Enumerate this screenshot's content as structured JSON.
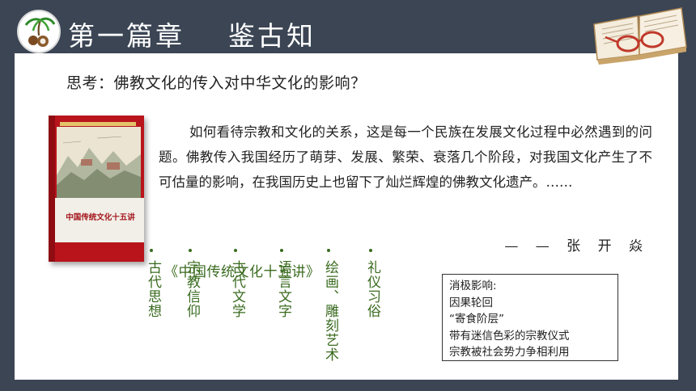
{
  "header": {
    "title": "第一篇章    鉴古知"
  },
  "question": "思考：佛教文化的传入对中华文化的影响？",
  "book": {
    "cover_title": "中国传统文化十五讲"
  },
  "paragraph": "如何看待宗教和文化的关系，这是每一个民族在发展文化过程中必然遇到的问题。佛教传入我国经历了萌芽、发展、繁荣、衰落几个阶段，对我国文化产生了不可估量的影响，在我国历史上也留下了灿烂辉煌的佛教文化遗产。……",
  "signature": "— — 张 开 焱",
  "book_reference": "《中国传统文化十五讲》",
  "influences": [
    "古代思想",
    "宗教信仰",
    "古代文学",
    "语言文字",
    "绘画、雕刻艺术",
    "礼仪习俗"
  ],
  "infobox": {
    "lines": [
      "消极影响:",
      "因果轮回",
      "“寄食阶层”",
      "带有迷信色彩的宗教仪式",
      "宗教被社会势力争相利用"
    ]
  },
  "colors": {
    "frame": "#3b4554",
    "accent_green": "#3a6b1f",
    "book_red": "#b9141b"
  }
}
